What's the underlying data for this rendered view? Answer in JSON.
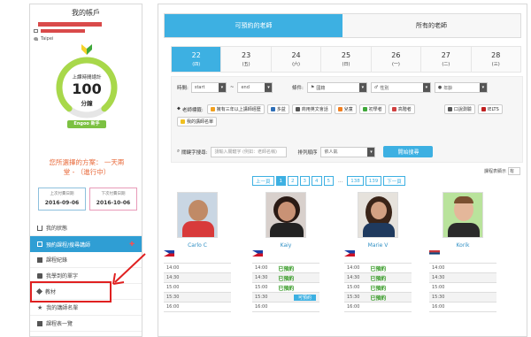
{
  "sidebar": {
    "title": "我的帳戶",
    "location": "Taipei",
    "gauge": {
      "label": "上課時間總計",
      "value": "100",
      "unit": "分鐘"
    },
    "rank": "Engoo 新手",
    "plan": {
      "line1": "您所選擇的方案： 一天兩",
      "line2": "堂 - （進行中）"
    },
    "last_date": {
      "label": "上次付費日期",
      "value": "2016-09-06"
    },
    "next_date": {
      "label": "下次付費日期",
      "value": "2016-10-06"
    },
    "nav": [
      {
        "label": "我的狀態"
      },
      {
        "label": "預約課程/搜尋講師"
      },
      {
        "label": "課程紀錄"
      },
      {
        "label": "我學到的單字"
      },
      {
        "label": "教材"
      },
      {
        "label": "我的講師名單"
      },
      {
        "label": "課程表一覽"
      }
    ]
  },
  "main": {
    "tabs": [
      {
        "label": "可預約的老師"
      },
      {
        "label": "所有的老師"
      }
    ],
    "days": [
      {
        "num": "22",
        "wk": "(四)"
      },
      {
        "num": "23",
        "wk": "(五)"
      },
      {
        "num": "24",
        "wk": "(六)"
      },
      {
        "num": "25",
        "wk": "(日)"
      },
      {
        "num": "26",
        "wk": "(一)"
      },
      {
        "num": "27",
        "wk": "(二)"
      },
      {
        "num": "28",
        "wk": "(三)"
      }
    ],
    "filters": {
      "time_label": "時間:",
      "start": "start",
      "tilde": "~",
      "end": "end",
      "cond_label": "條件:",
      "country": "國籍",
      "gender": "性別",
      "age": "年齡",
      "tag_label": "老師標籤:",
      "tags": [
        "擁有三年以上講師經歷",
        "多益",
        "商用英文會話",
        "兒童",
        "初學者",
        "高階者",
        "口說測驗",
        "IELTS",
        "我的講師名單"
      ],
      "keyword_label": "關鍵字搜尋:",
      "keyword_placeholder": "請輸入關鍵字 (例如：老師名稱)",
      "sort_label": "排列順序",
      "sort_value": "依人氣",
      "search_button": "開始搜尋"
    },
    "per_page_label": "課程表顯示",
    "per_page_value": "有",
    "pager": [
      "上一頁",
      "1",
      "2",
      "3",
      "4",
      "5",
      "...",
      "138",
      "139",
      "下一頁"
    ],
    "teachers": [
      {
        "name": "Carlo C",
        "flag": "philippines",
        "slots": [
          {
            "time": "14:00",
            "status": "",
            "book": ""
          },
          {
            "time": "14:30",
            "status": "",
            "book": ""
          },
          {
            "time": "15:00",
            "status": "",
            "book": ""
          },
          {
            "time": "15:30",
            "status": "",
            "book": ""
          },
          {
            "time": "16:00",
            "status": "",
            "book": ""
          }
        ]
      },
      {
        "name": "Kaiy",
        "flag": "philippines",
        "slots": [
          {
            "time": "14:00",
            "status": "已預約",
            "book": ""
          },
          {
            "time": "14:30",
            "status": "已預約",
            "book": ""
          },
          {
            "time": "15:00",
            "status": "已預約",
            "book": ""
          },
          {
            "time": "15:30",
            "status": "",
            "book": "可預約"
          },
          {
            "time": "16:00",
            "status": "",
            "book": ""
          }
        ]
      },
      {
        "name": "Marie V",
        "flag": "philippines",
        "slots": [
          {
            "time": "14:00",
            "status": "已預約",
            "book": ""
          },
          {
            "time": "14:30",
            "status": "已預約",
            "book": ""
          },
          {
            "time": "15:00",
            "status": "已預約",
            "book": ""
          },
          {
            "time": "15:30",
            "status": "已預約",
            "book": ""
          },
          {
            "time": "16:00",
            "status": "",
            "book": ""
          }
        ]
      },
      {
        "name": "Korik",
        "flag": "serbia",
        "slots": [
          {
            "time": "14:00",
            "status": "",
            "book": ""
          },
          {
            "time": "14:30",
            "status": "",
            "book": ""
          },
          {
            "time": "15:00",
            "status": "",
            "book": ""
          },
          {
            "time": "15:30",
            "status": "",
            "book": ""
          },
          {
            "time": "16:00",
            "status": "",
            "book": ""
          }
        ]
      }
    ]
  },
  "colors": {
    "accent": "#3db0e2",
    "booked": "#3a9c2a",
    "plan": "#e8693a",
    "highlight": "#e02020"
  }
}
